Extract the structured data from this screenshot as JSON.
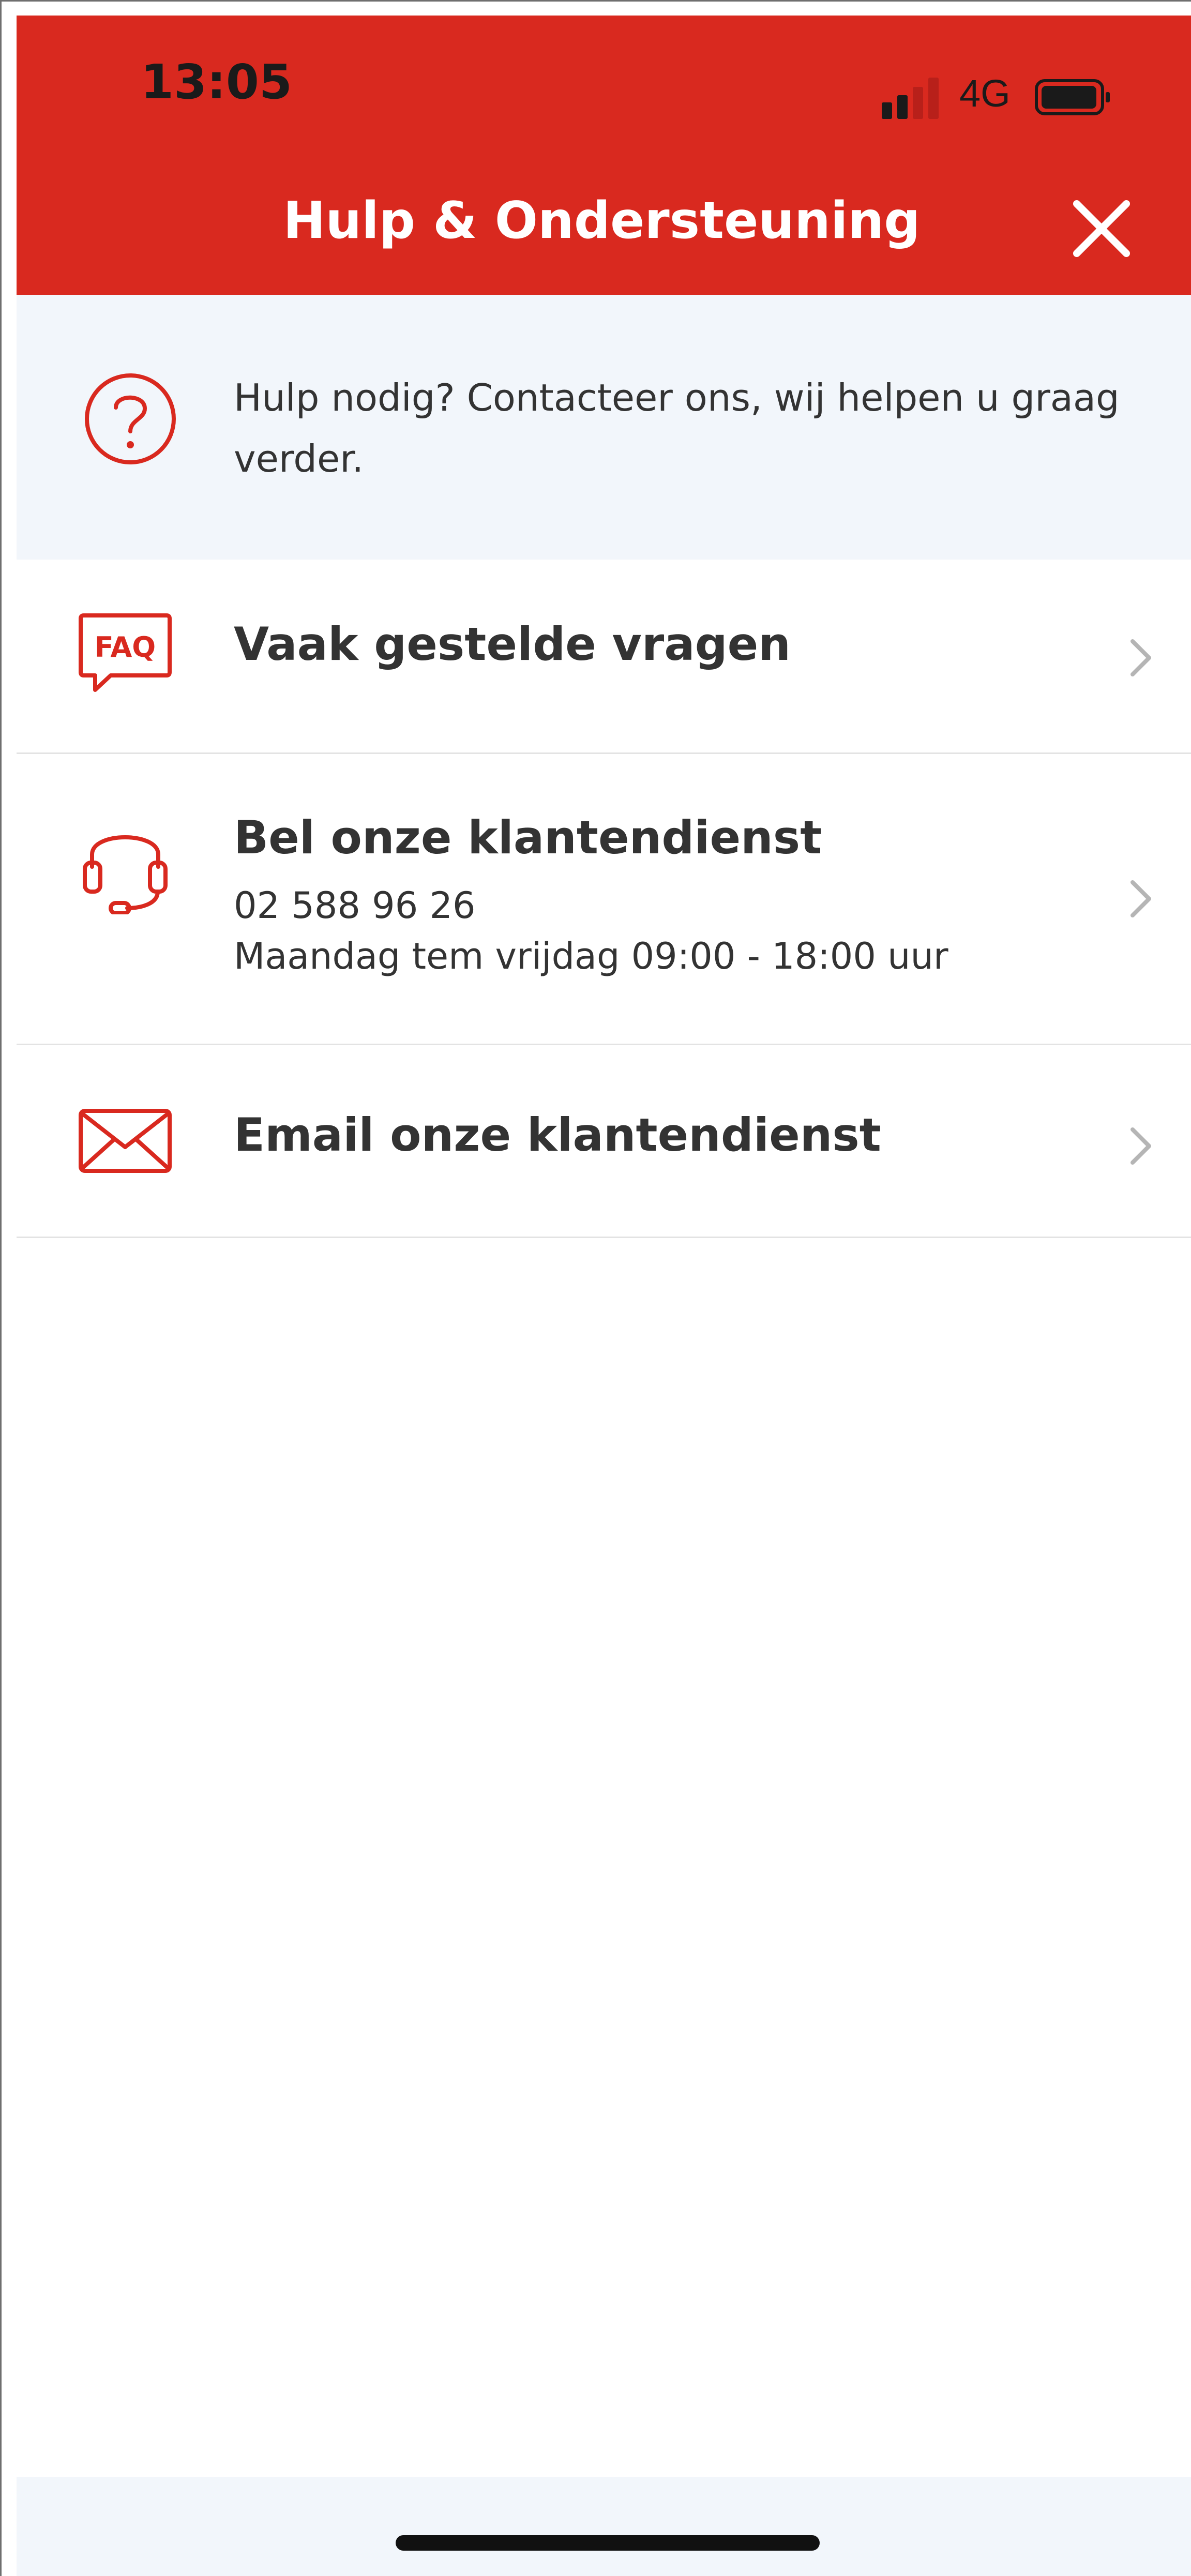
{
  "status_bar": {
    "time": "13:05",
    "network": "4G"
  },
  "header": {
    "title": "Hulp & Ondersteuning",
    "close_icon": "close-icon",
    "background_color": "#d9291f"
  },
  "banner": {
    "icon": "question-circle-icon",
    "text": "Hulp nodig? Contacteer ons, wij helpen u graag verder."
  },
  "items": [
    {
      "icon": "faq-icon",
      "title": "Vaak gestelde vragen"
    },
    {
      "icon": "headset-icon",
      "title": "Bel onze klantendienst",
      "phone": "02 588 96 26",
      "hours": "Maandag tem vrijdag 09:00 - 18:00 uur"
    },
    {
      "icon": "envelope-icon",
      "title": "Email onze klantendienst"
    }
  ],
  "accent_color": "#d9291f"
}
